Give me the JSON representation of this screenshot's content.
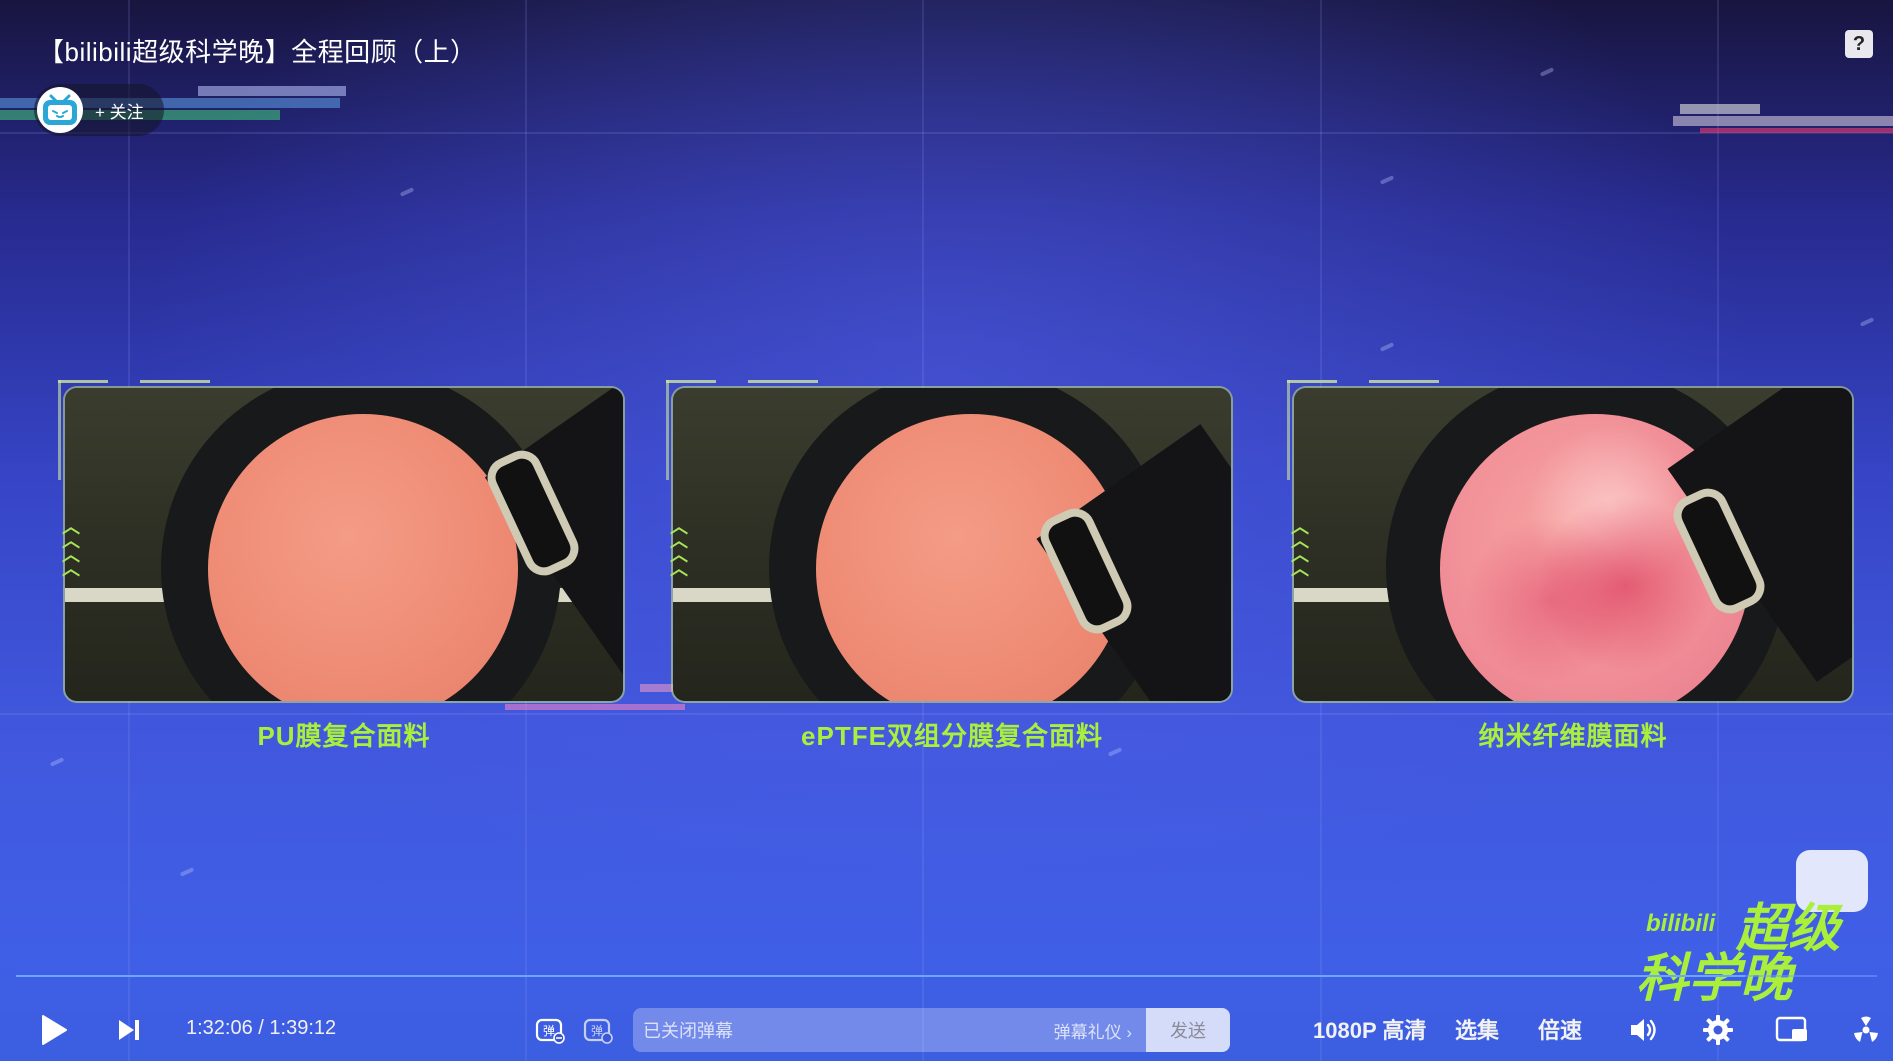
{
  "video": {
    "title": "【bilibili超级科学晚】全程回顾（上）",
    "follow_label": "+ 关注",
    "help_label": "?"
  },
  "panels": [
    {
      "caption": "PU膜复合面料"
    },
    {
      "caption": "ePTFE双组分膜复合面料"
    },
    {
      "caption": "纳米纤维膜面料"
    }
  ],
  "watermark": {
    "brand": "bilibili",
    "line1": "超级",
    "line2": "科学晚"
  },
  "player": {
    "current_time": "1:32:06",
    "separator": "/",
    "duration": "1:39:12",
    "progress_fraction": 0.929,
    "danmaku_placeholder": "已关闭弹幕",
    "danmaku_etiquette": "弹幕礼仪 ›",
    "send_label": "发送",
    "quality_label": "1080P 高清",
    "episodes_label": "选集",
    "speed_label": "倍速"
  },
  "colors": {
    "accent_green": "#a9ef3c",
    "bg_blue": "#3c5ee0",
    "progress": "#6ba7ff"
  },
  "icons": [
    "play-icon",
    "next-icon",
    "danmaku-toggle-icon",
    "danmaku-settings-icon",
    "volume-icon",
    "settings-icon",
    "pip-icon",
    "fullscreen-icon",
    "bilibili-tv-icon",
    "help-icon"
  ]
}
